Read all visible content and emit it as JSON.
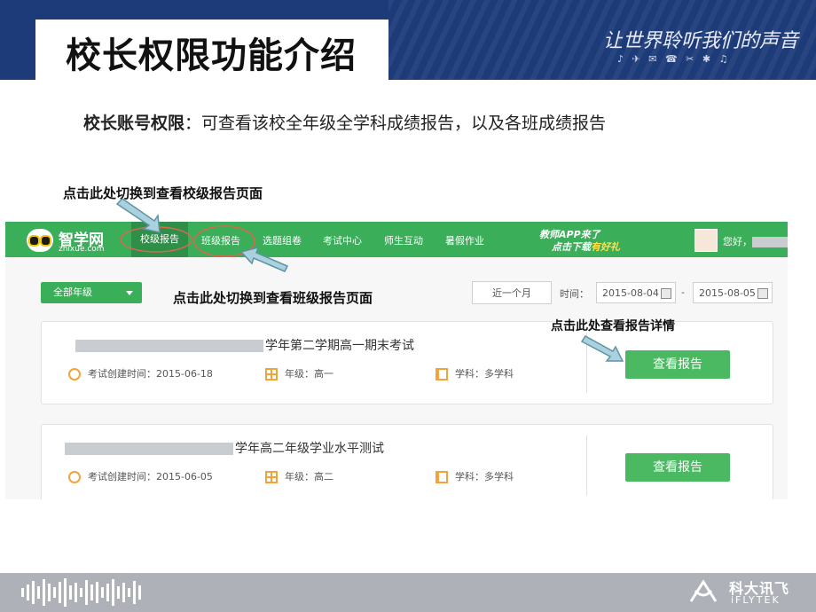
{
  "slide": {
    "title": "校长权限功能介绍",
    "slogan": "让世界聆听我们的声音",
    "intro_label": "校长账号权限",
    "intro_text": "：可查看该校全年级全学科成绩报告，以及各班成绩报告"
  },
  "annotations": {
    "school_report": "点击此处切换到查看校级报告页面",
    "class_report": "点击此处切换到查看班级报告页面",
    "view_detail": "点击此处查看报告详情"
  },
  "app": {
    "logo_name": "智学网",
    "logo_domain": "zhixue.com",
    "nav": [
      {
        "label": "校级报告"
      },
      {
        "label": "班级报告"
      },
      {
        "label": "选题组卷"
      },
      {
        "label": "考试中心"
      },
      {
        "label": "师生互动"
      },
      {
        "label": "暑假作业"
      }
    ],
    "promo_line1": "教师APP来了",
    "promo_line2_prefix": "点击下载",
    "promo_line2_highlight": "有好礼",
    "greeting": "您好，",
    "grade_filter": "全部年级",
    "range_button": "近一个月",
    "time_label": "时间：",
    "date_from": "2015-08-04",
    "date_to": "2015-08-05",
    "date_separator": "-"
  },
  "exams": [
    {
      "title_suffix": "学年第二学期高一期末考试",
      "created_label": "考试创建时间：2015-06-18",
      "grade_label": "年级：高一",
      "subject_label": "学科：多学科",
      "button": "查看报告"
    },
    {
      "title_suffix": "学年高二年级学业水平测试",
      "created_label": "考试创建时间：2015-06-05",
      "grade_label": "年级：高二",
      "subject_label": "学科：多学科",
      "button": "查看报告"
    }
  ],
  "footer": {
    "brand_cn": "科大讯飞",
    "brand_en": "iFLYTEK"
  },
  "colors": {
    "header_blue": "#1d3b78",
    "app_green": "#3bae5a",
    "button_green": "#4bb862",
    "callout_arrow": "#a9d2de",
    "highlight_oval": "#d9684e"
  },
  "icons": [
    "clock-icon",
    "grid-icon",
    "book-icon",
    "calendar-icon",
    "chevron-down-icon",
    "owl-logo-icon",
    "arrow-icon"
  ]
}
